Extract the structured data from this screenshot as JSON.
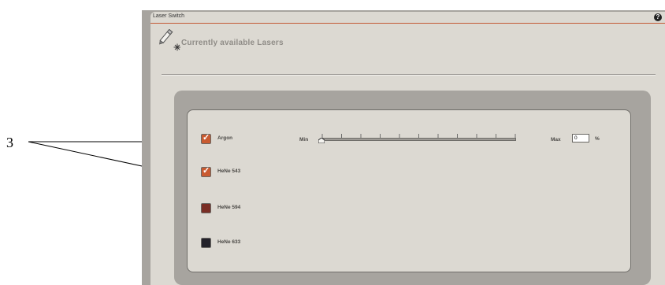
{
  "callout": {
    "number": "3"
  },
  "window": {
    "title": "Laser Switch",
    "help_glyph": "?"
  },
  "section": {
    "heading": "Currently available Lasers",
    "icon": "laser-pen-icon"
  },
  "lasers": [
    {
      "name": "Argon",
      "checked": true,
      "color": "#c95a30"
    },
    {
      "name": "HeNe 543",
      "checked": true,
      "color": "#c95a30"
    },
    {
      "name": "HeNe 594",
      "checked": false,
      "color": "#7a2e25"
    },
    {
      "name": "HeNe 633",
      "checked": false,
      "color": "#23222a"
    }
  ],
  "power_slider": {
    "min_label": "Min",
    "max_label": "Max",
    "value": "0",
    "unit": "%",
    "fraction": 0
  },
  "colors": {
    "accent_line": "#c45a36",
    "panel_bg": "#dcd9d2",
    "frame_bg": "#a7a49f"
  }
}
